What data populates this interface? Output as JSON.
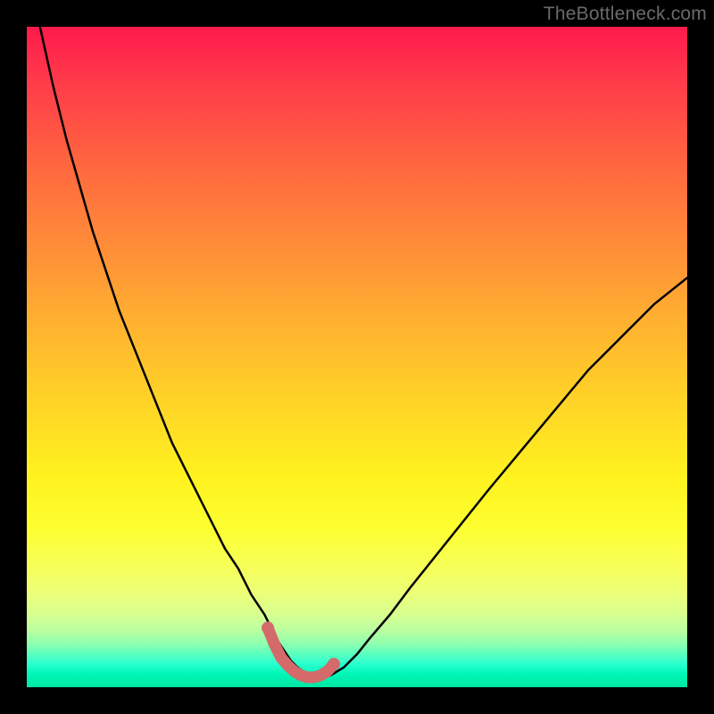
{
  "watermark": "TheBottleneck.com",
  "colors": {
    "curve_stroke": "#000000",
    "flat_marker_stroke": "#d46a6a",
    "flat_marker_fill": "#d46a6a"
  },
  "chart_data": {
    "type": "line",
    "title": "",
    "xlabel": "",
    "ylabel": "",
    "xlim": [
      0,
      100
    ],
    "ylim": [
      0,
      100
    ],
    "grid": false,
    "legend": false,
    "x": [
      0,
      2,
      4,
      6,
      8,
      10,
      12,
      14,
      16,
      18,
      20,
      22,
      24,
      26,
      28,
      30,
      32,
      34,
      36,
      37,
      38,
      39,
      40,
      41,
      42,
      43,
      44,
      45,
      46,
      48,
      50,
      52,
      55,
      58,
      62,
      66,
      70,
      75,
      80,
      85,
      90,
      95,
      100
    ],
    "y": [
      115,
      100,
      91,
      83,
      76,
      69,
      63,
      57,
      52,
      47,
      42,
      37,
      33,
      29,
      25,
      21,
      18,
      14,
      11,
      9,
      7,
      5.5,
      4,
      3,
      2.3,
      1.8,
      1.5,
      1.5,
      1.8,
      3,
      5,
      7.5,
      11,
      15,
      20,
      25,
      30,
      36,
      42,
      48,
      53,
      58,
      62
    ],
    "flat_region": {
      "x": [
        36.5,
        37.5,
        38.5,
        39.5,
        40.5,
        41.5,
        42.5,
        43.5,
        44.5,
        45.5,
        46.5
      ],
      "y": [
        9.0,
        6.5,
        4.5,
        3.3,
        2.4,
        1.8,
        1.5,
        1.5,
        1.8,
        2.4,
        3.5
      ]
    }
  }
}
